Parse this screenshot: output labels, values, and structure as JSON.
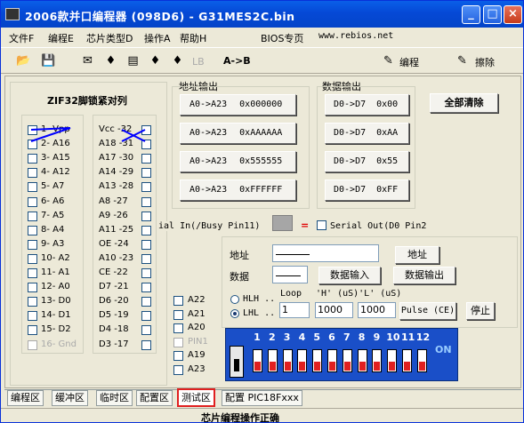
{
  "title": "2006款并口编程器 (098D6) - G31MES2C.bin",
  "menu": [
    "文件F",
    "编程E",
    "芯片类型D",
    "操作A",
    "帮助H",
    "BIOS专页",
    "www.rebios.net"
  ],
  "toolbar": {
    "lb": "LB",
    "ab": "A->B",
    "program": "编程",
    "erase": "擦除"
  },
  "zif": {
    "title": "ZIF32脚锁紧对列",
    "left": [
      "1- Vpp",
      "2- A16",
      "3- A15",
      "4- A12",
      "5- A7",
      "6- A6",
      "7- A5",
      "8- A4",
      "9- A3",
      "10- A2",
      "11- A1",
      "12- A0",
      "13- D0",
      "14- D1",
      "15- D2",
      "16- Gnd"
    ],
    "right": [
      "Vcc -32",
      "A18 -31",
      "A17 -30",
      "A14 -29",
      "A13 -28",
      "A8 -27",
      "A9 -26",
      "A11 -25",
      "OE -24",
      "A10 -23",
      "CE -22",
      "D7 -21",
      "D6 -20",
      "D5 -19",
      "D4 -18",
      "D3 -17"
    ]
  },
  "addr_out": {
    "title": "地址输出",
    "buttons": [
      [
        "A0->A23",
        "0x000000"
      ],
      [
        "A0->A23",
        "0xAAAAAA"
      ],
      [
        "A0->A23",
        "0x555555"
      ],
      [
        "A0->A23",
        "0xFFFFFF"
      ]
    ]
  },
  "data_out": {
    "title": "数据输出",
    "buttons": [
      [
        "D0->D7",
        "0x00"
      ],
      [
        "D0->D7",
        "0xAA"
      ],
      [
        "D0->D7",
        "0x55"
      ],
      [
        "D0->D7",
        "0xFF"
      ]
    ]
  },
  "clear_all": "全部清除",
  "serial_in": "ial In(/Busy Pin11)",
  "equals": "=",
  "serial_out": "Serial Out(D0 Pin2",
  "extra_pins": [
    "A22",
    "A21",
    "A20",
    "PIN1",
    "A19",
    "A23"
  ],
  "test": {
    "addr_label": "地址",
    "data_label": "数据",
    "addr_btn": "地址",
    "data_in_btn": "数据输入",
    "data_out_btn": "数据输出",
    "hlh": "HLH ..",
    "lhl": "LHL ..",
    "loop": "Loop",
    "h_us": "'H' (uS)'L' (uS)",
    "loop_val": "1",
    "h_val": "1000",
    "l_val": "1000",
    "pulse_btn": "Pulse (CE)",
    "stop_btn": "停止"
  },
  "dip": {
    "nums": [
      "1",
      "2",
      "3",
      "4",
      "5",
      "6",
      "7",
      "8",
      "9",
      "10",
      "11",
      "12"
    ],
    "on": "ON"
  },
  "tabs": [
    "编程区",
    "缓冲区",
    "临时区",
    "配置区",
    "测试区",
    "配置 PIC18Fxxx"
  ],
  "status": "芯片编程操作正确"
}
